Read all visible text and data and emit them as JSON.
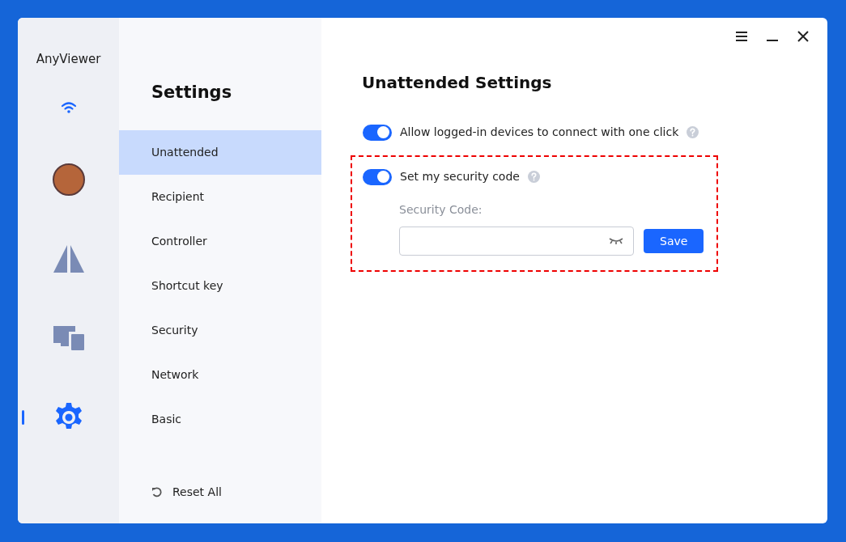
{
  "app": {
    "name": "AnyViewer"
  },
  "rail_items": [
    {
      "kind": "connection",
      "selected": false
    },
    {
      "kind": "avatar",
      "selected": false
    },
    {
      "kind": "split",
      "selected": false
    },
    {
      "kind": "devices",
      "selected": false
    },
    {
      "kind": "settings",
      "selected": true
    }
  ],
  "settings_nav": {
    "title": "Settings",
    "items": [
      {
        "label": "Unattended",
        "selected": true
      },
      {
        "label": "Recipient",
        "selected": false
      },
      {
        "label": "Controller",
        "selected": false
      },
      {
        "label": "Shortcut key",
        "selected": false
      },
      {
        "label": "Security",
        "selected": false
      },
      {
        "label": "Network",
        "selected": false
      },
      {
        "label": "Basic",
        "selected": false
      }
    ],
    "reset": "Reset All"
  },
  "content": {
    "title": "Unattended Settings",
    "options": [
      {
        "label": "Allow logged-in devices to connect with one click",
        "on": true,
        "highlighted": false
      },
      {
        "label": "Set my security code",
        "on": true,
        "highlighted": true,
        "field_label": "Security Code:",
        "button": "Save"
      }
    ]
  }
}
